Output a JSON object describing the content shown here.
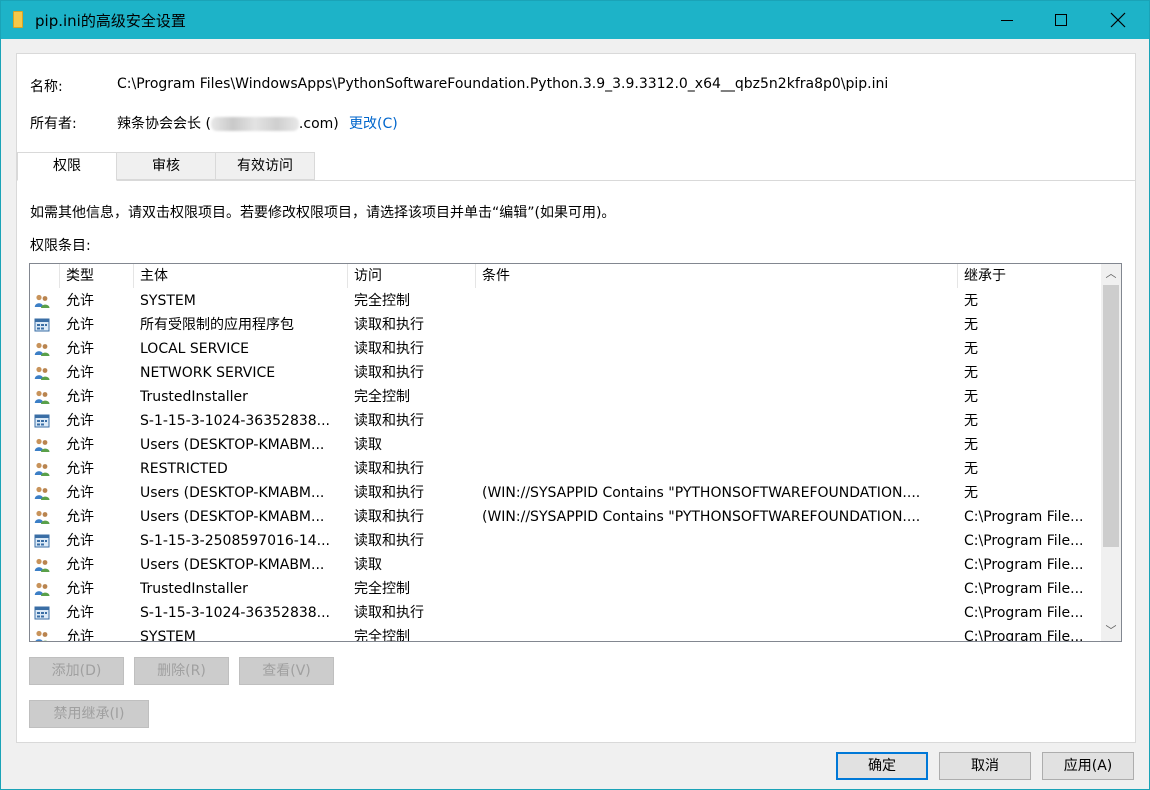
{
  "window": {
    "title": "pip.ini的高级安全设置"
  },
  "file_info": {
    "name_label": "名称:",
    "name_value": "C:\\Program Files\\WindowsApps\\PythonSoftwareFoundation.Python.3.9_3.9.3312.0_x64__qbz5n2kfra8p0\\pip.ini",
    "owner_label": "所有者:",
    "owner_prefix": "辣条协会会长 (",
    "owner_suffix": ".com)",
    "change_link": "更改(C)"
  },
  "tabs": [
    {
      "label": "权限",
      "active": true
    },
    {
      "label": "审核",
      "active": false
    },
    {
      "label": "有效访问",
      "active": false
    }
  ],
  "info_text": "如需其他信息，请双击权限项目。若要修改权限项目，请选择该项目并单击“编辑”(如果可用)。",
  "entries_label": "权限条目:",
  "table": {
    "headers": {
      "type": "类型",
      "principal": "主体",
      "access": "访问",
      "condition": "条件",
      "inherited": "继承于"
    },
    "rows": [
      {
        "icon": "group",
        "type": "允许",
        "principal": "SYSTEM",
        "access": "完全控制",
        "condition": "",
        "inherited": "无"
      },
      {
        "icon": "package",
        "type": "允许",
        "principal": "所有受限制的应用程序包",
        "access": "读取和执行",
        "condition": "",
        "inherited": "无"
      },
      {
        "icon": "group",
        "type": "允许",
        "principal": "LOCAL SERVICE",
        "access": "读取和执行",
        "condition": "",
        "inherited": "无"
      },
      {
        "icon": "group",
        "type": "允许",
        "principal": "NETWORK SERVICE",
        "access": "读取和执行",
        "condition": "",
        "inherited": "无"
      },
      {
        "icon": "group",
        "type": "允许",
        "principal": "TrustedInstaller",
        "access": "完全控制",
        "condition": "",
        "inherited": "无"
      },
      {
        "icon": "package",
        "type": "允许",
        "principal": "S-1-15-3-1024-36352838...",
        "access": "读取和执行",
        "condition": "",
        "inherited": "无"
      },
      {
        "icon": "group",
        "type": "允许",
        "principal": "Users (DESKTOP-KMABM...",
        "access": "读取",
        "condition": "",
        "inherited": "无"
      },
      {
        "icon": "group",
        "type": "允许",
        "principal": "RESTRICTED",
        "access": "读取和执行",
        "condition": "",
        "inherited": "无"
      },
      {
        "icon": "group",
        "type": "允许",
        "principal": "Users (DESKTOP-KMABM...",
        "access": "读取和执行",
        "condition": "(WIN://SYSAPPID Contains \"PYTHONSOFTWAREFOUNDATION....",
        "inherited": "无"
      },
      {
        "icon": "group",
        "type": "允许",
        "principal": "Users (DESKTOP-KMABM...",
        "access": "读取和执行",
        "condition": "(WIN://SYSAPPID Contains \"PYTHONSOFTWAREFOUNDATION....",
        "inherited": "C:\\Program File..."
      },
      {
        "icon": "package",
        "type": "允许",
        "principal": "S-1-15-3-2508597016-14...",
        "access": "读取和执行",
        "condition": "",
        "inherited": "C:\\Program File..."
      },
      {
        "icon": "group",
        "type": "允许",
        "principal": "Users (DESKTOP-KMABM...",
        "access": "读取",
        "condition": "",
        "inherited": "C:\\Program File..."
      },
      {
        "icon": "group",
        "type": "允许",
        "principal": "TrustedInstaller",
        "access": "完全控制",
        "condition": "",
        "inherited": "C:\\Program File..."
      },
      {
        "icon": "package",
        "type": "允许",
        "principal": "S-1-15-3-1024-36352838...",
        "access": "读取和执行",
        "condition": "",
        "inherited": "C:\\Program File..."
      },
      {
        "icon": "group",
        "type": "允许",
        "principal": "SYSTEM",
        "access": "完全控制",
        "condition": "",
        "inherited": "C:\\Program File..."
      }
    ]
  },
  "buttons": {
    "add": "添加(D)",
    "remove": "删除(R)",
    "view": "查看(V)",
    "disable_inheritance": "禁用继承(I)",
    "ok": "确定",
    "cancel": "取消",
    "apply": "应用(A)"
  },
  "colors": {
    "titlebar": "#1db3c8",
    "link": "#0066cc",
    "primary_border": "#0078d7"
  }
}
